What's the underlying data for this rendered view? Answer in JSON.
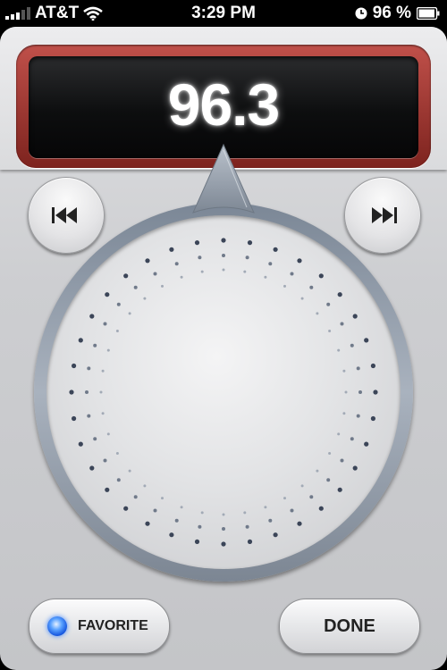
{
  "status_bar": {
    "carrier": "AT&T",
    "time": "3:29 PM",
    "battery": "96 %"
  },
  "tuner": {
    "frequency": "96.3"
  },
  "controls": {
    "favorite_label": "FAVORITE",
    "done_label": "DONE",
    "prev_icon": "skip-back-icon",
    "next_icon": "skip-forward-icon"
  },
  "colors": {
    "display_frame": "#a8362f",
    "favorite_led": "#2f7cff",
    "dial_ring": "#8d97a4"
  }
}
